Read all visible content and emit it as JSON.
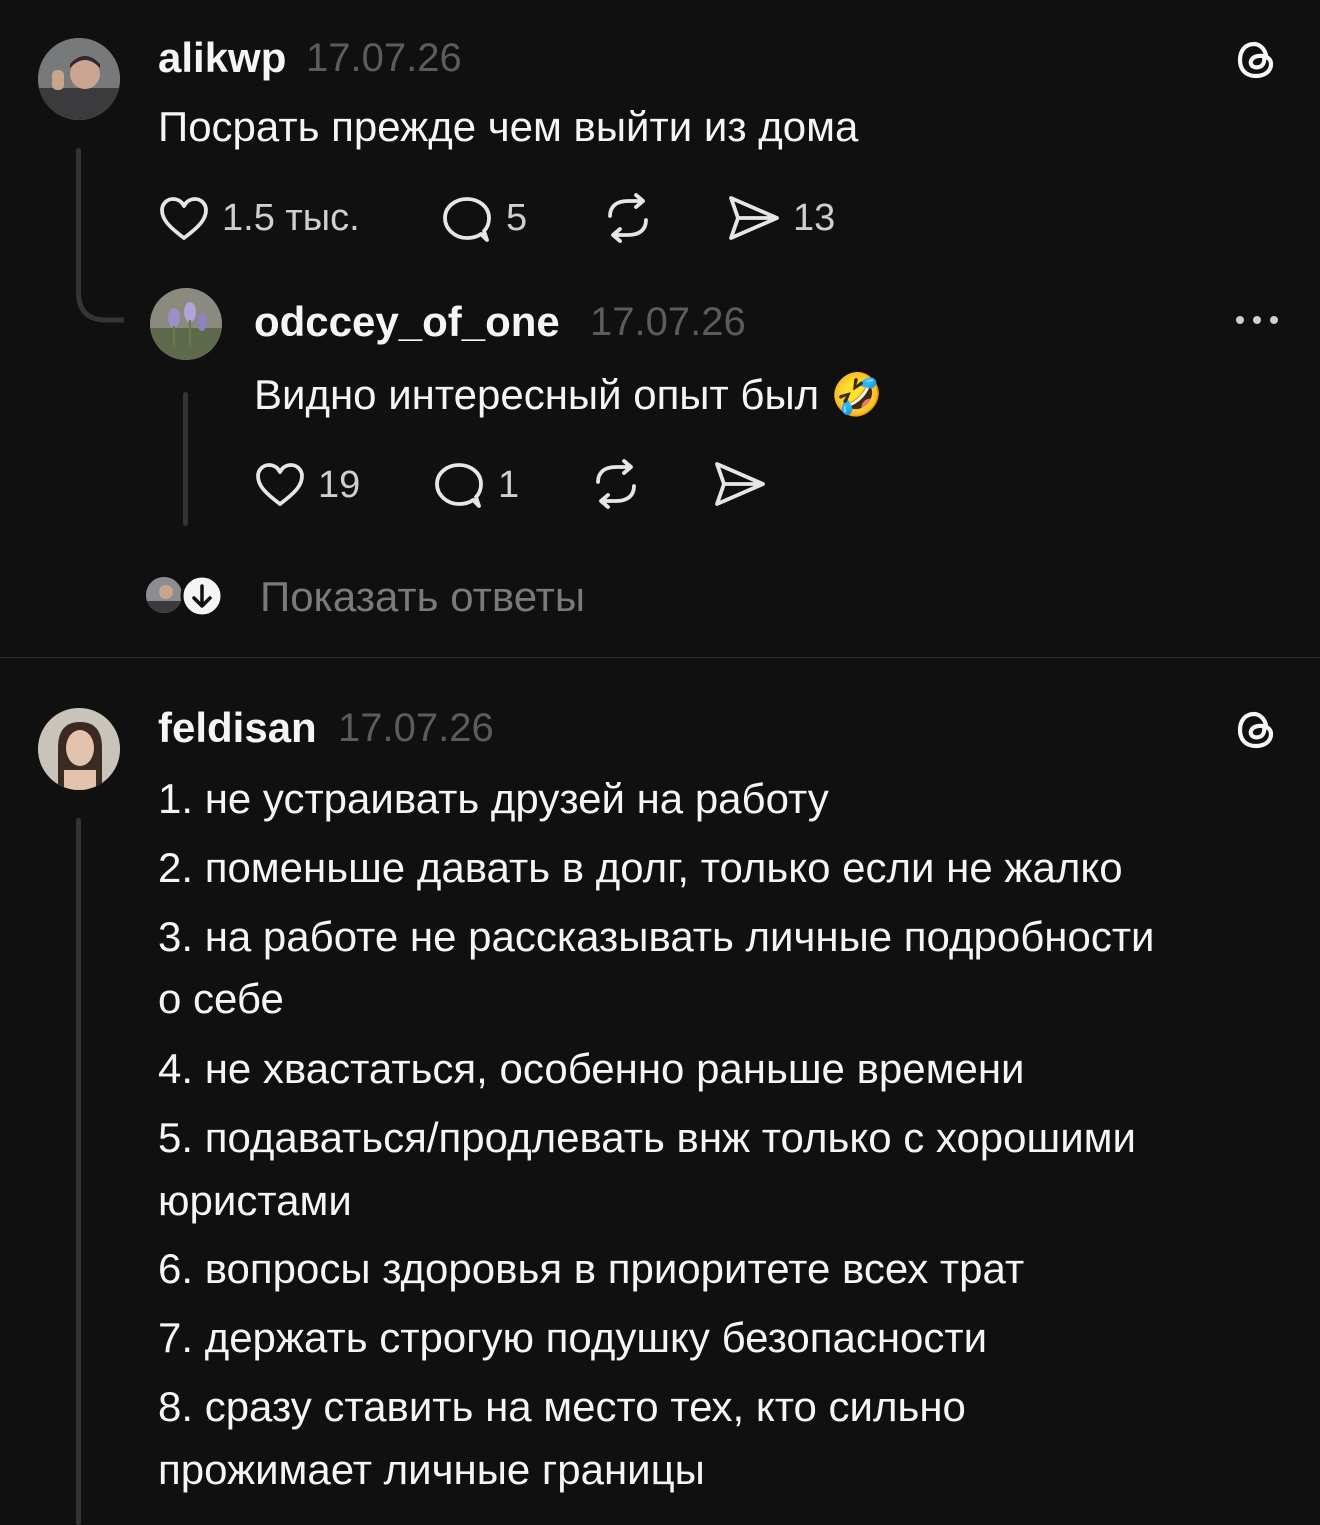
{
  "posts": [
    {
      "username": "alikwp",
      "date": "17.07.26",
      "text": "Посрать прежде чем выйти из дома",
      "likes": "1.5 тыс.",
      "comments": "5",
      "shares": "13",
      "avatar_icon": "user-avatar-man",
      "corner_icon": "threads-logo-icon"
    },
    {
      "username": "feldisan",
      "date": "17.07.26",
      "lines": [
        "1. не устраивать друзей на работу",
        "2. поменьше давать в долг, только если не жалко",
        "3. на работе не рассказывать личные подробности",
        "о себе",
        "4. не хвастаться, особенно раньше времени",
        "5. подаваться/продлевать внж только с хорошими",
        "юристами",
        "6. вопросы здоровья в приоритете всех трат",
        "7. держать строгую подушку безопасности",
        "8. сразу ставить на место тех, кто сильно",
        "прожимает личные границы"
      ],
      "avatar_icon": "user-avatar-woman",
      "corner_icon": "threads-logo-icon"
    }
  ],
  "reply": {
    "username": "odccey_of_one",
    "date": "17.07.26",
    "text": "Видно интересный опыт был 🤣",
    "likes": "19",
    "comments": "1",
    "menu_icon": "more-options-icon"
  },
  "show_replies": {
    "label": "Показать ответы",
    "icon": "arrow-down-circle-icon"
  },
  "colors": {
    "background": "#101010",
    "text": "#f3f5f7",
    "muted": "#5c5c5c",
    "line": "#333638"
  }
}
